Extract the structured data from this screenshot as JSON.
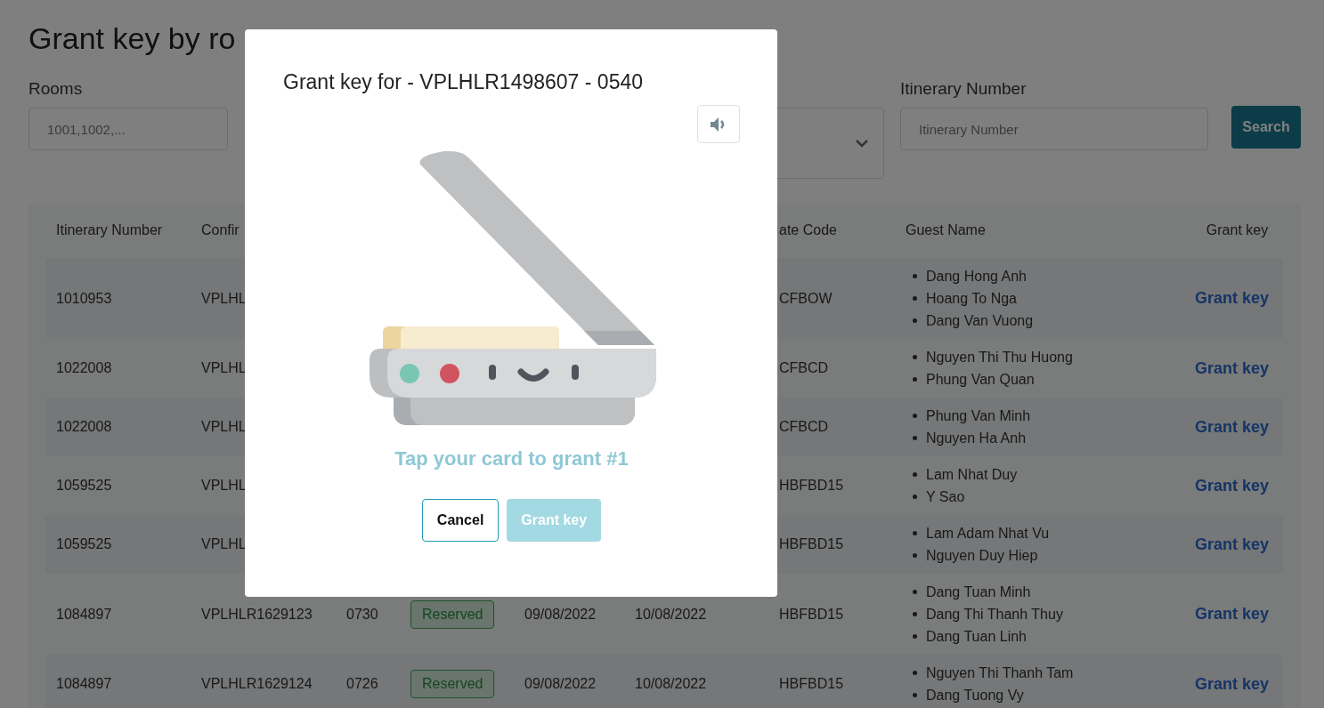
{
  "page": {
    "title": "Grant key by ro"
  },
  "filters": {
    "rooms": {
      "label": "Rooms",
      "placeholder": "1001,1002,..."
    },
    "itinerary": {
      "label": "Itinerary Number",
      "placeholder": "Itinerary Number"
    },
    "search_button": "Search"
  },
  "table": {
    "headers": {
      "itinerary": "Itinerary Number",
      "confirmation": "Confir",
      "rate_code": "ate Code",
      "guest_name": "Guest Name",
      "grant_key": "Grant key"
    },
    "rows": [
      {
        "itinerary": "1010953",
        "confirmation": "VPLHL",
        "rate_code": "CFBOW",
        "guests": [
          "Dang Hong Anh",
          "Hoang To Nga",
          "Dang Van Vuong"
        ],
        "action": "Grant key"
      },
      {
        "itinerary": "1022008",
        "confirmation": "VPLHL",
        "rate_code": "CFBCD",
        "guests": [
          "Nguyen Thi Thu Huong",
          "Phung Van Quan"
        ],
        "action": "Grant key"
      },
      {
        "itinerary": "1022008",
        "confirmation": "VPLHL",
        "rate_code": "CFBCD",
        "guests": [
          "Phung Van Minh",
          "Nguyen Ha Anh"
        ],
        "action": "Grant key"
      },
      {
        "itinerary": "1059525",
        "confirmation": "VPLHL",
        "rate_code": "HBFBD15",
        "guests": [
          "Lam Nhat Duy",
          "Y Sao"
        ],
        "action": "Grant key"
      },
      {
        "itinerary": "1059525",
        "confirmation": "VPLHL",
        "rate_code": "HBFBD15",
        "guests": [
          "Lam Adam Nhat Vu",
          "Nguyen Duy Hiep"
        ],
        "action": "Grant key"
      },
      {
        "itinerary": "1084897",
        "confirmation": "VPLHLR1629123",
        "room": "0730",
        "status": "Reserved",
        "check_in": "09/08/2022",
        "check_out": "10/08/2022",
        "rate_code": "HBFBD15",
        "guests": [
          "Dang Tuan Minh",
          "Dang Thi Thanh Thuy",
          "Dang Tuan Linh"
        ],
        "action": "Grant key"
      },
      {
        "itinerary": "1084897",
        "confirmation": "VPLHLR1629124",
        "room": "0726",
        "status": "Reserved",
        "check_in": "09/08/2022",
        "check_out": "10/08/2022",
        "rate_code": "HBFBD15",
        "guests": [
          "Nguyen Thi Thanh Tam",
          "Dang Tuong Vy"
        ],
        "action": "Grant key"
      }
    ]
  },
  "dialog": {
    "title": "Grant key for - VPLHLR1498607 - 0540",
    "message": "Tap your card to grant #1",
    "buttons": [
      {
        "kind": "cancel",
        "label": "Cancel"
      },
      {
        "kind": "primary",
        "label": "Grant key",
        "disabled": true
      }
    ]
  }
}
